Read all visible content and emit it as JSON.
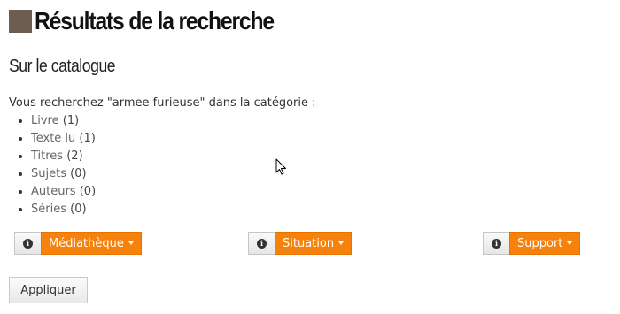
{
  "page_title": "Résultats de la recherche",
  "section_title": "Sur le catalogue",
  "query_intro": "Vous recherchez \"armee furieuse\" dans la catégorie :",
  "categories": [
    {
      "label": "Livre",
      "count": "(1)"
    },
    {
      "label": "Texte lu",
      "count": "(1)"
    },
    {
      "label": "Titres",
      "count": "(2)"
    },
    {
      "label": "Sujets",
      "count": "(0)"
    },
    {
      "label": "Auteurs",
      "count": "(0)"
    },
    {
      "label": "Séries",
      "count": "(0)"
    }
  ],
  "filters": {
    "mediatheque": {
      "label": "Médiathèque",
      "icon": "info-icon"
    },
    "situation": {
      "label": "Situation",
      "icon": "info-icon"
    },
    "support": {
      "label": "Support",
      "icon": "info-icon"
    }
  },
  "apply_button": "Appliquer",
  "colors": {
    "accent": "#f7820b",
    "title_square": "#6b5d52"
  }
}
